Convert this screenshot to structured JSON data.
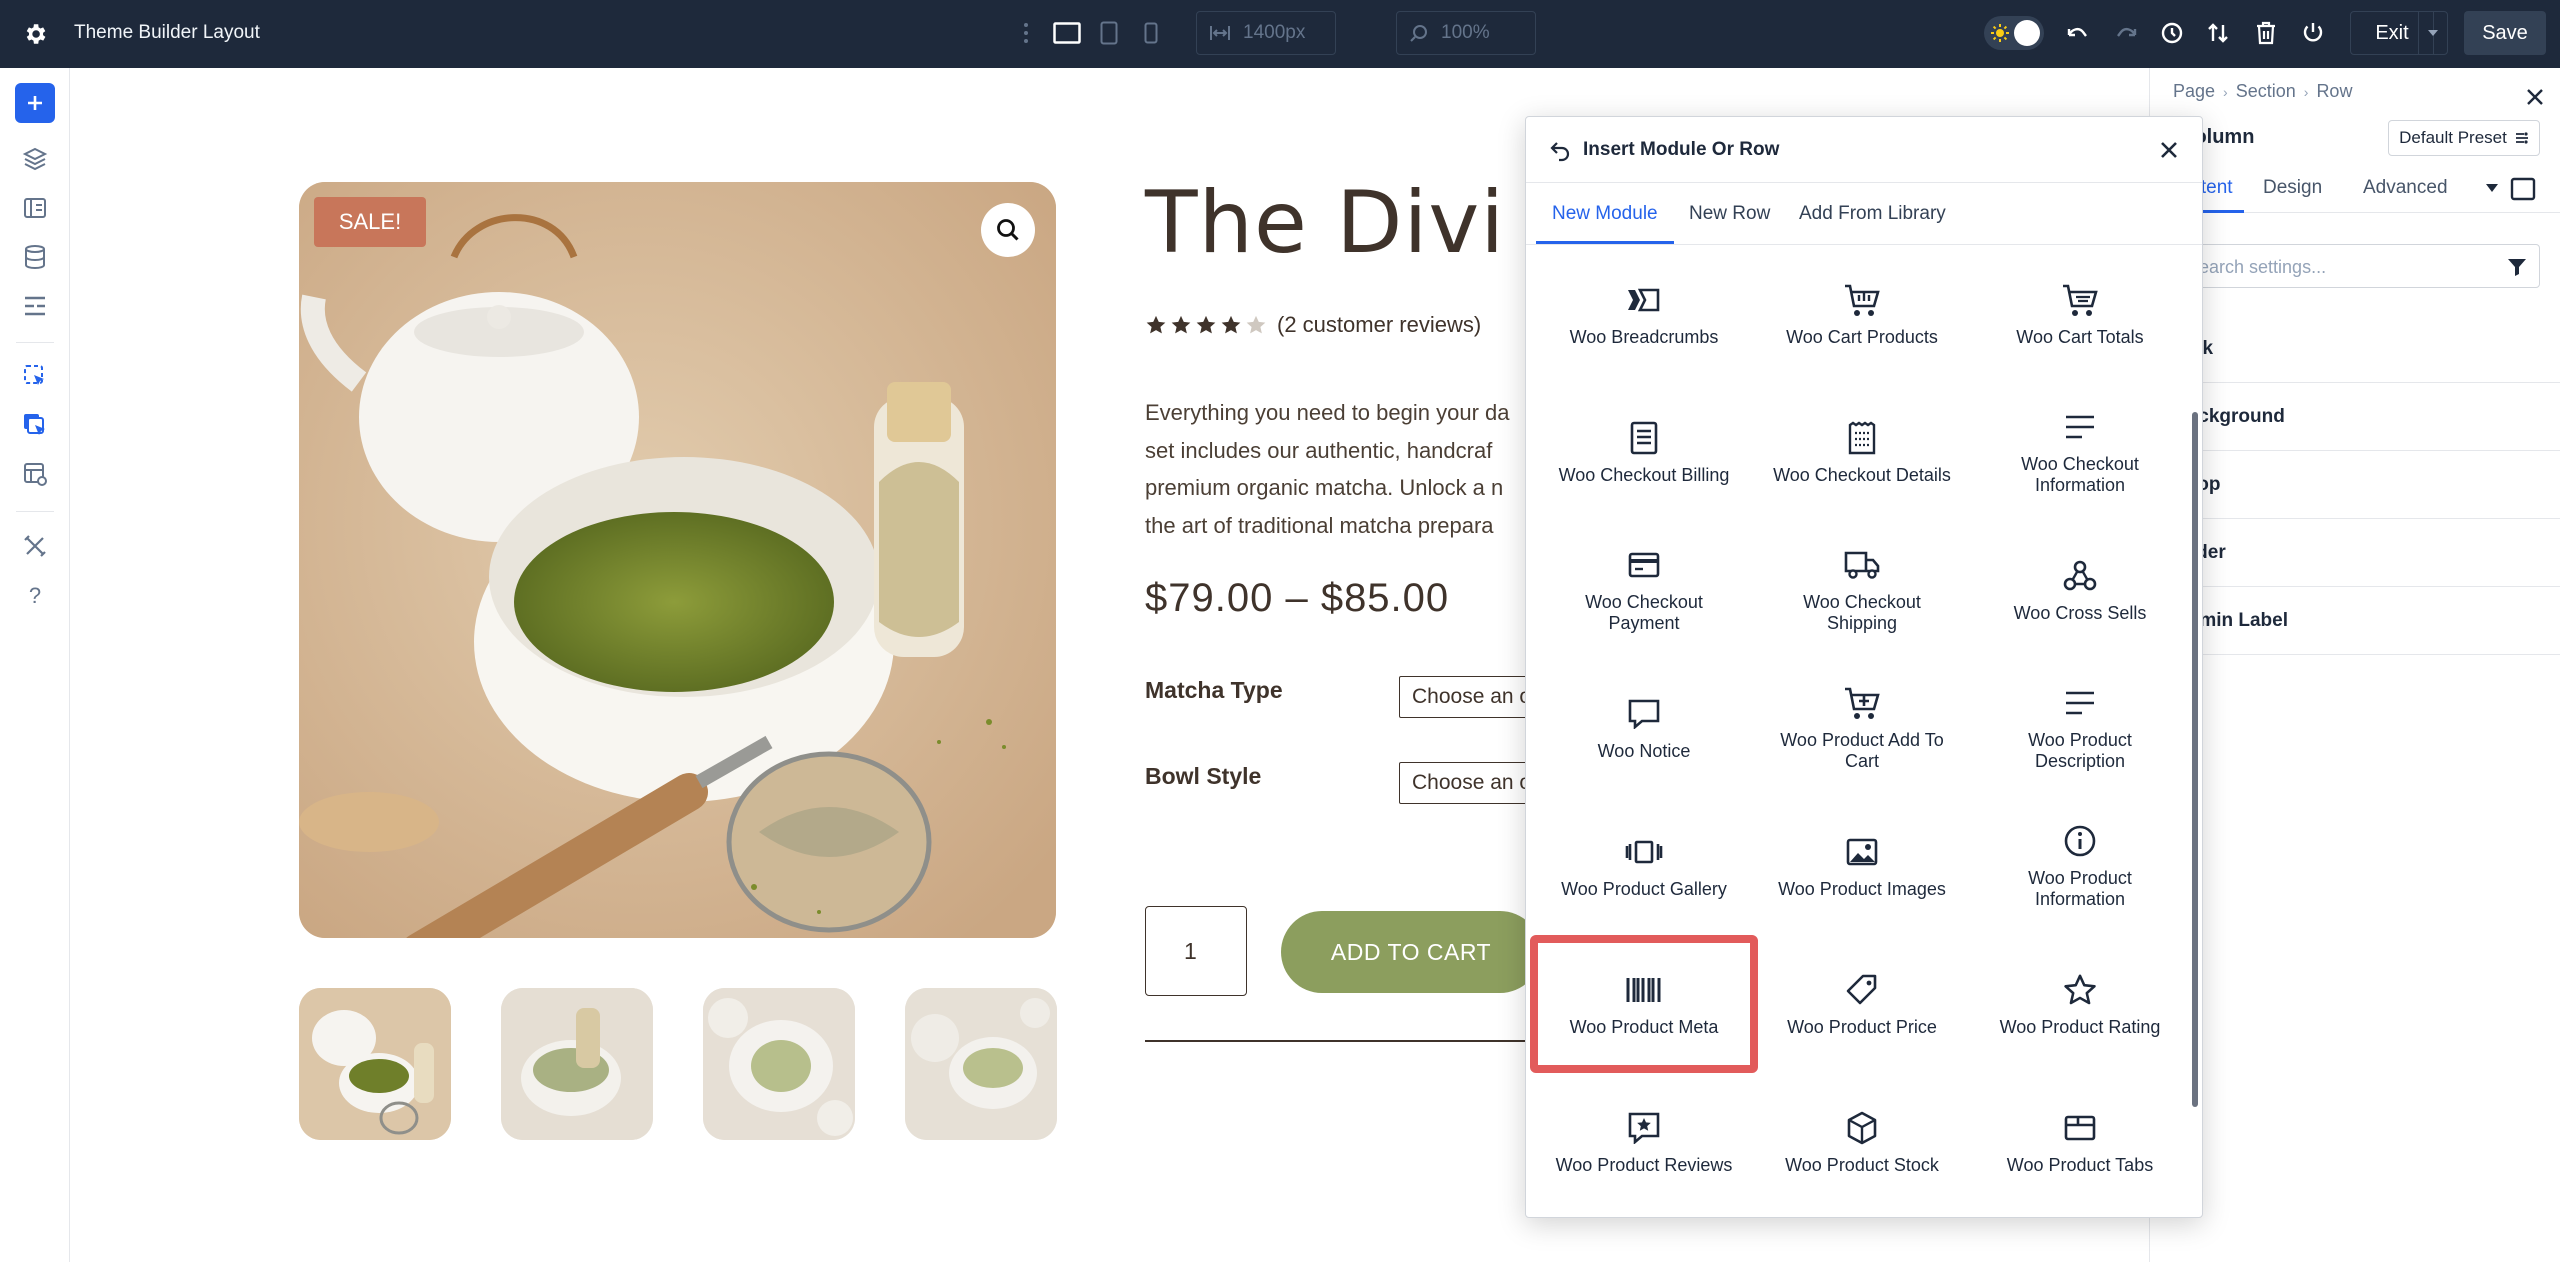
{
  "topbar": {
    "title": "Theme Builder Layout",
    "width_field": "1400px",
    "zoom_field": "100%",
    "exit_label": "Exit",
    "save_label": "Save"
  },
  "canvas": {
    "sale_badge": "SALE!",
    "product_title": "The Divi R",
    "rating_stars": 4,
    "reviews": "(2 customer reviews)",
    "description_lines": [
      "Everything you need to begin your da",
      "set includes our authentic, handcraf",
      "premium organic matcha. Unlock a n",
      "the art of traditional matcha prepara"
    ],
    "price": "$79.00 – $85.00",
    "attribute_1_label": "Matcha Type",
    "attribute_1_value": "Choose an o",
    "attribute_2_label": "Bowl Style",
    "attribute_2_value": "Choose an o",
    "quantity": "1",
    "add_to_cart": "ADD TO CART"
  },
  "settings": {
    "breadcrumb": [
      "Page",
      "Section",
      "Row"
    ],
    "title": "Column",
    "preset": "Default Preset",
    "tabs": [
      "Content",
      "Design",
      "Advanced"
    ],
    "search_placeholder": "Search settings...",
    "groups": [
      "Link",
      "Background",
      "Loop",
      "Order",
      "Admin Label"
    ]
  },
  "modal": {
    "title": "Insert Module Or Row",
    "tabs": [
      "New Module",
      "New Row",
      "Add From Library"
    ],
    "modules": [
      {
        "label": "Woo Breadcrumbs",
        "icon": "breadcrumbs-icon"
      },
      {
        "label": "Woo Cart Products",
        "icon": "cart-icon"
      },
      {
        "label": "Woo Cart Totals",
        "icon": "cart-totals-icon"
      },
      {
        "label": "Woo Checkout Billing",
        "icon": "billing-icon"
      },
      {
        "label": "Woo Checkout Details",
        "icon": "details-icon"
      },
      {
        "label": "Woo Checkout Information",
        "icon": "information-lines-icon"
      },
      {
        "label": "Woo Checkout Payment",
        "icon": "payment-card-icon"
      },
      {
        "label": "Woo Checkout Shipping",
        "icon": "shipping-truck-icon"
      },
      {
        "label": "Woo Cross Sells",
        "icon": "cross-sells-icon"
      },
      {
        "label": "Woo Notice",
        "icon": "notice-icon"
      },
      {
        "label": "Woo Product Add To Cart",
        "icon": "add-to-cart-icon"
      },
      {
        "label": "Woo Product Description",
        "icon": "description-icon"
      },
      {
        "label": "Woo Product Gallery",
        "icon": "gallery-icon"
      },
      {
        "label": "Woo Product Images",
        "icon": "image-icon"
      },
      {
        "label": "Woo Product Information",
        "icon": "info-circle-icon"
      },
      {
        "label": "Woo Product Meta",
        "icon": "barcode-icon"
      },
      {
        "label": "Woo Product Price",
        "icon": "price-tag-icon"
      },
      {
        "label": "Woo Product Rating",
        "icon": "star-icon"
      },
      {
        "label": "Woo Product Reviews",
        "icon": "review-star-icon"
      },
      {
        "label": "Woo Product Stock",
        "icon": "stock-box-icon"
      },
      {
        "label": "Woo Product Tabs",
        "icon": "tabs-icon"
      }
    ],
    "highlighted_module": "Woo Product Meta",
    "highlight_color": "#e25b5b"
  },
  "colors": {
    "topbar_bg": "#1e293b",
    "accent": "#2563eb",
    "add_to_cart": "#8c9e5e",
    "sale_badge": "#c8765a"
  }
}
